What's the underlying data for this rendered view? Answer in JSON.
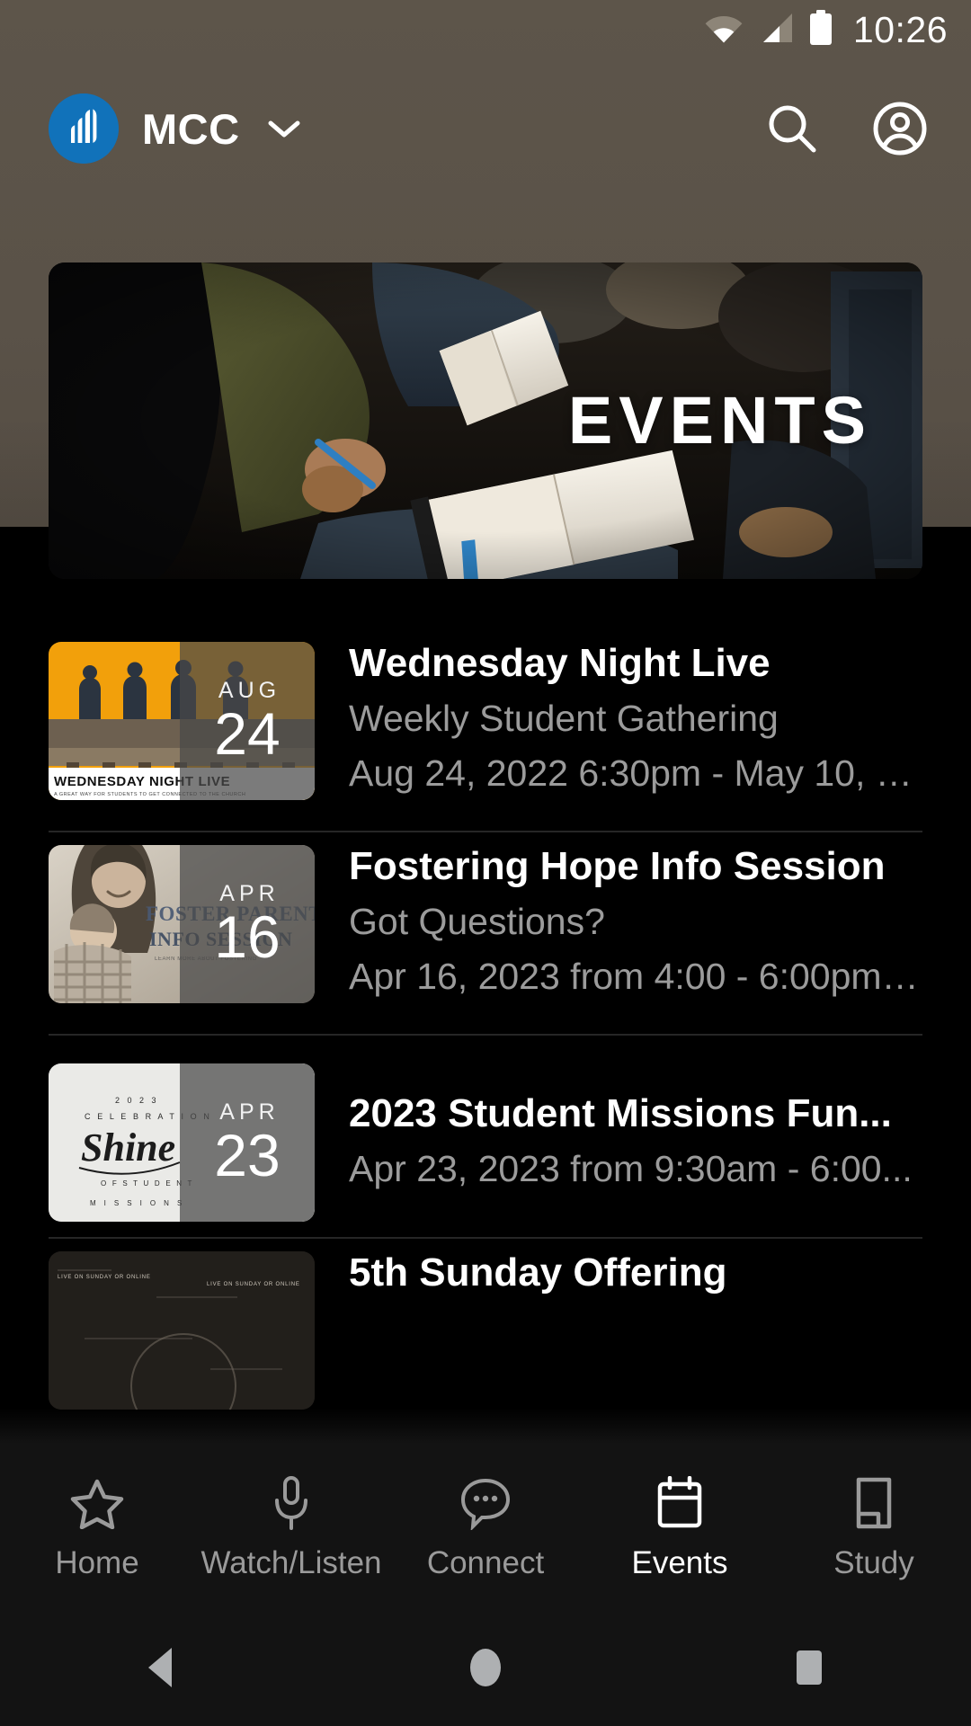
{
  "status_bar": {
    "time": "10:26",
    "icons": [
      "wifi-icon",
      "cellular-signal-icon",
      "battery-icon"
    ]
  },
  "app_bar": {
    "logo": "mcc-logo-icon",
    "brand_name": "MCC",
    "dropdown_icon": "chevron-down-icon",
    "search_icon": "search-icon",
    "account_icon": "account-circle-icon"
  },
  "hero": {
    "title": "EVENTS",
    "image_alt": "people seated with open books and notebooks"
  },
  "events": [
    {
      "title": "Wednesday Night Live",
      "subtitle": "Weekly Student Gathering",
      "date_line": "Aug 24, 2022 6:30pm - May 10, 2...",
      "badge_month": "AUG",
      "badge_day": "24",
      "thumb_caption": "WEDNESDAY NIGHT LIVE",
      "thumb_subcaption": "A GREAT WAY FOR STUDENTS TO GET CONNECTED TO THE CHURCH"
    },
    {
      "title": "Fostering Hope Info Session",
      "subtitle": "Got Questions?",
      "date_line": "Apr 16, 2023 from 4:00 - 6:00pm ...",
      "badge_month": "APR",
      "badge_day": "16",
      "thumb_caption": "FOSTER PARENT",
      "thumb_subcaption": "INFO SESSION"
    },
    {
      "title": "2023 Student Missions Fun...",
      "subtitle": "",
      "date_line": "Apr 23, 2023 from 9:30am - 6:00...",
      "badge_month": "APR",
      "badge_day": "23",
      "thumb_caption": "Shine",
      "thumb_subcaption": "2023 CELEBRATION OF STUDENT MISSIONS"
    },
    {
      "title": "5th Sunday Offering",
      "subtitle": "",
      "date_line": "",
      "badge_month": "",
      "badge_day": "",
      "thumb_caption": "LIVE ON SUNDAY OR ONLINE",
      "thumb_subcaption": "LIVE ON SUNDAY OR ONLINE"
    }
  ],
  "bottom_nav": {
    "active": "Events",
    "items": [
      {
        "label": "Home",
        "icon": "star-icon"
      },
      {
        "label": "Watch/Listen",
        "icon": "microphone-icon"
      },
      {
        "label": "Connect",
        "icon": "chat-bubble-icon"
      },
      {
        "label": "Events",
        "icon": "calendar-icon"
      },
      {
        "label": "Study",
        "icon": "book-icon"
      }
    ]
  },
  "system_nav": {
    "back": "back-triangle-icon",
    "home": "home-circle-icon",
    "recents": "recents-square-icon"
  },
  "colors": {
    "header_backdrop": "#5a5248",
    "page_background": "#000000",
    "nav_background": "#131313",
    "brand_blue": "#1172ba",
    "accent_orange": "#f2a00b",
    "muted_text": "#9b9b9b",
    "active_text": "#ffffff",
    "divider": "#262626"
  }
}
